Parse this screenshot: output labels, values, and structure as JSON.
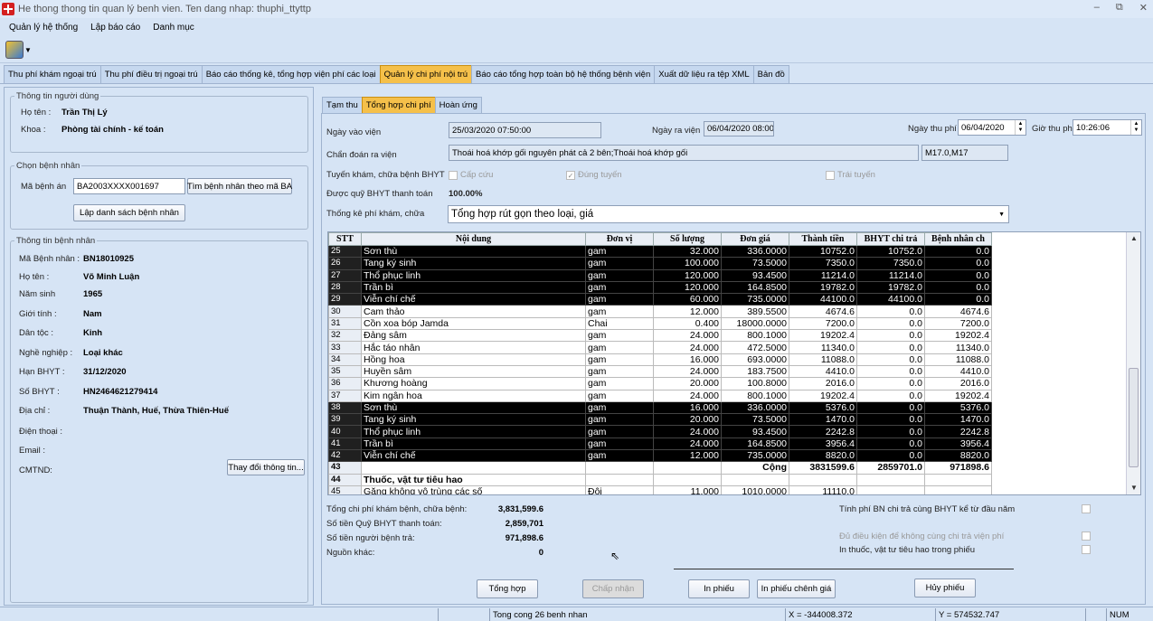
{
  "window": {
    "title": "He thong thong tin quan lý benh vien. Ten dang nhap: thuphi_ttyttp",
    "controls": [
      "–",
      "⧉",
      "✕"
    ]
  },
  "menu": [
    "Quản lý hệ thống",
    "Lập báo cáo",
    "Danh mục"
  ],
  "main_tabs": [
    "Thu phí khám ngoại trú",
    "Thu phí điều trị ngoại trú",
    "Báo cáo thống kê, tổng hợp viện phí các loại",
    "Quản lý chi phí nội trú",
    "Báo cáo tổng hợp toàn bộ hệ thống bệnh viện",
    "Xuất dữ liệu ra tệp XML",
    "Bản đồ"
  ],
  "user_info": {
    "legend": "Thông tin người dùng",
    "name_label": "Họ tên :",
    "name": "Trần Thị Lý",
    "dept_label": "Khoa :",
    "dept": "Phòng tài chính - kế toán"
  },
  "select_patient": {
    "legend": "Chọn bệnh nhân",
    "code_label": "Mã bệnh án",
    "code_value": "BA2003XXXX001697",
    "find_button": "Tìm bệnh nhân theo mã BA",
    "list_button": "Lập danh sách bệnh nhân"
  },
  "patient_info": {
    "legend": "Thông tin bệnh nhân",
    "fields": [
      {
        "label": "Mã Bệnh nhân :",
        "value": "BN18010925"
      },
      {
        "label": "Họ tên :",
        "value": "Võ Minh Luận"
      },
      {
        "label": "Năm sinh",
        "value": "1965"
      },
      {
        "label": "Giới tính :",
        "value": "Nam"
      },
      {
        "label": "Dân tộc :",
        "value": "Kinh"
      },
      {
        "label": "Nghề nghiệp :",
        "value": "Loại khác"
      },
      {
        "label": "Hạn BHYT :",
        "value": "31/12/2020"
      },
      {
        "label": "Số BHYT :",
        "value": "HN2464621279414"
      },
      {
        "label": "Địa chỉ :",
        "value": "Thuận Thành, Huế, Thừa Thiên-Huế"
      },
      {
        "label": "Điện thoại :",
        "value": ""
      },
      {
        "label": "Email :",
        "value": ""
      },
      {
        "label": "CMTND:",
        "value": ""
      }
    ],
    "change_button": "Thay đổi thông tin..."
  },
  "sub_tabs": [
    "Tạm thu",
    "Tổng hợp chi phí",
    "Hoàn ứng"
  ],
  "form": {
    "admit_label": "Ngày vào viện",
    "admit_value": "25/03/2020 07:50:00",
    "discharge_label": "Ngày ra viện",
    "discharge_value": "06/04/2020 08:00",
    "pay_date_label": "Ngày thu phí",
    "pay_date_value": "06/04/2020",
    "pay_time_label": "Giờ thu phí",
    "pay_time_value": "10:26:06",
    "diag_label": "Chẩn đoán ra viện",
    "diag_value": "Thoái hoá khớp gối nguyên phát cả 2 bên;Thoái hoá khớp gối",
    "diag_code": "M17.0,M17",
    "route_label": "Tuyến khám, chữa bệnh BHYT",
    "route_emergency": "Cấp cứu",
    "route_correct": "Đúng tuyến",
    "route_wrong": "Trái tuyến",
    "insurance_label": "Được quỹ BHYT thanh toán",
    "insurance_value": "100.00%",
    "stat_label": "Thống kê phí khám, chữa",
    "stat_value": "Tổng hợp rút gọn theo loại, giá"
  },
  "grid": {
    "headers": [
      "STT",
      "Nội dung",
      "Đơn vị",
      "Số lượng",
      "Đơn giá",
      "Thành tiền",
      "BHYT chi trả",
      "Bệnh nhân ch"
    ],
    "rows": [
      {
        "stt": "25",
        "name": "Sơn thù",
        "unit": "gam",
        "qty": "32.000",
        "price": "336.0000",
        "total": "10752.0",
        "bhyt": "10752.0",
        "patient": "0.0",
        "dark": true
      },
      {
        "stt": "26",
        "name": "Tang ký sinh",
        "unit": "gam",
        "qty": "100.000",
        "price": "73.5000",
        "total": "7350.0",
        "bhyt": "7350.0",
        "patient": "0.0",
        "dark": true
      },
      {
        "stt": "27",
        "name": "Thổ phục linh",
        "unit": "gam",
        "qty": "120.000",
        "price": "93.4500",
        "total": "11214.0",
        "bhyt": "11214.0",
        "patient": "0.0",
        "dark": true
      },
      {
        "stt": "28",
        "name": "Trần bì",
        "unit": "gam",
        "qty": "120.000",
        "price": "164.8500",
        "total": "19782.0",
        "bhyt": "19782.0",
        "patient": "0.0",
        "dark": true
      },
      {
        "stt": "29",
        "name": "Viễn chí chế",
        "unit": "gam",
        "qty": "60.000",
        "price": "735.0000",
        "total": "44100.0",
        "bhyt": "44100.0",
        "patient": "0.0",
        "dark": true
      },
      {
        "stt": "30",
        "name": "Cam thảo",
        "unit": "gam",
        "qty": "12.000",
        "price": "389.5500",
        "total": "4674.6",
        "bhyt": "0.0",
        "patient": "4674.6"
      },
      {
        "stt": "31",
        "name": "Cồn xoa bóp Jamda",
        "unit": "Chai",
        "qty": "0.400",
        "price": "18000.0000",
        "total": "7200.0",
        "bhyt": "0.0",
        "patient": "7200.0"
      },
      {
        "stt": "32",
        "name": "Đảng sâm",
        "unit": "gam",
        "qty": "24.000",
        "price": "800.1000",
        "total": "19202.4",
        "bhyt": "0.0",
        "patient": "19202.4"
      },
      {
        "stt": "33",
        "name": "Hắc táo nhân",
        "unit": "gam",
        "qty": "24.000",
        "price": "472.5000",
        "total": "11340.0",
        "bhyt": "0.0",
        "patient": "11340.0"
      },
      {
        "stt": "34",
        "name": "Hồng hoa",
        "unit": "gam",
        "qty": "16.000",
        "price": "693.0000",
        "total": "11088.0",
        "bhyt": "0.0",
        "patient": "11088.0"
      },
      {
        "stt": "35",
        "name": "Huyền sâm",
        "unit": "gam",
        "qty": "24.000",
        "price": "183.7500",
        "total": "4410.0",
        "bhyt": "0.0",
        "patient": "4410.0"
      },
      {
        "stt": "36",
        "name": "Khương hoàng",
        "unit": "gam",
        "qty": "20.000",
        "price": "100.8000",
        "total": "2016.0",
        "bhyt": "0.0",
        "patient": "2016.0"
      },
      {
        "stt": "37",
        "name": "Kim ngân hoa",
        "unit": "gam",
        "qty": "24.000",
        "price": "800.1000",
        "total": "19202.4",
        "bhyt": "0.0",
        "patient": "19202.4"
      },
      {
        "stt": "38",
        "name": "Sơn thù",
        "unit": "gam",
        "qty": "16.000",
        "price": "336.0000",
        "total": "5376.0",
        "bhyt": "0.0",
        "patient": "5376.0",
        "dark": true
      },
      {
        "stt": "39",
        "name": "Tang ký sinh",
        "unit": "gam",
        "qty": "20.000",
        "price": "73.5000",
        "total": "1470.0",
        "bhyt": "0.0",
        "patient": "1470.0",
        "dark": true
      },
      {
        "stt": "40",
        "name": "Thổ phục linh",
        "unit": "gam",
        "qty": "24.000",
        "price": "93.4500",
        "total": "2242.8",
        "bhyt": "0.0",
        "patient": "2242.8",
        "dark": true
      },
      {
        "stt": "41",
        "name": "Trần bì",
        "unit": "gam",
        "qty": "24.000",
        "price": "164.8500",
        "total": "3956.4",
        "bhyt": "0.0",
        "patient": "3956.4",
        "dark": true
      },
      {
        "stt": "42",
        "name": "Viễn chí chế",
        "unit": "gam",
        "qty": "12.000",
        "price": "735.0000",
        "total": "8820.0",
        "bhyt": "0.0",
        "patient": "8820.0",
        "dark": true
      },
      {
        "stt": "43",
        "name": "",
        "unit": "",
        "qty": "",
        "price": "Cộng",
        "total": "3831599.6",
        "bhyt": "2859701.0",
        "patient": "971898.6",
        "bold": true
      },
      {
        "stt": "44",
        "name": "Thuốc, vật tư tiêu hao",
        "unit": "",
        "qty": "",
        "price": "",
        "total": "",
        "bhyt": "",
        "patient": "",
        "bold": true
      },
      {
        "stt": "45",
        "name": "Găng không vô trùng các số",
        "unit": "Đôi",
        "qty": "11.000",
        "price": "1010.0000",
        "total": "11110.0",
        "bhyt": "",
        "patient": ""
      }
    ]
  },
  "summary": {
    "total_label": "Tổng chi phí khám bệnh, chữa bệnh:",
    "total_value": "3,831,599.6",
    "bhyt_label": "Số tiền Quỹ BHYT thanh toán:",
    "bhyt_value": "2,859,701",
    "patient_label": "Số tiền người bệnh trả:",
    "patient_value": "971,898.6",
    "other_label": "Nguồn khác:",
    "other_value": "0"
  },
  "options": {
    "opt1": "Tính phí BN chi trả cùng BHYT kể từ đầu năm",
    "opt2": "Đủ điều kiện để không cùng chi trả viện phí",
    "opt3": "In thuốc, vật tư tiêu hao trong phiếu"
  },
  "buttons": {
    "summary": "Tổng hợp",
    "accept": "Chấp nhận",
    "print": "In phiếu",
    "print_diff": "In phiếu chênh giá",
    "cancel": "Hủy phiếu"
  },
  "status": {
    "count": "Tong cong 26 benh nhan",
    "x": "X = -344008.372",
    "y": "Y = 574532.747",
    "num": "NUM"
  }
}
